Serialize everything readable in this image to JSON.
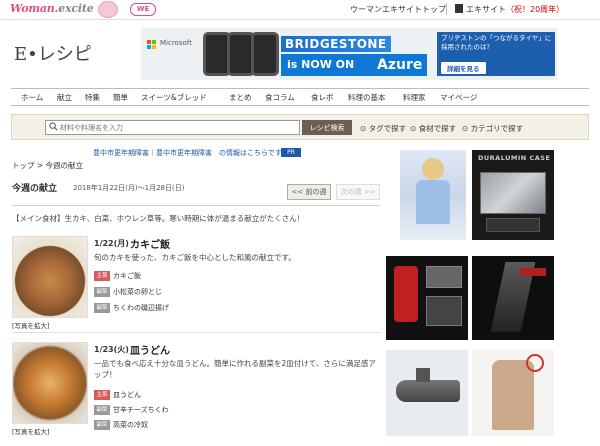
{
  "topbar": {
    "brand_part1": "Woman.",
    "brand_part2": "excite",
    "we_badge": "WE",
    "link1": "ウーマンエキサイトトップ",
    "link2_prefix": "エキサイト",
    "link2_red": "（祝！20周年）"
  },
  "logo": "E•レシピ",
  "banner": {
    "microsoft": "Microsoft",
    "title": "BRIDGESTONE",
    "now_prefix": "is NOW ON",
    "now_brand": "Azure",
    "side_text": "ブリヂストンの「つながるタイヤ」に採用されたのは？",
    "cta": "詳細を見る"
  },
  "nav": [
    "ホーム",
    "献立",
    "特集",
    "簡単",
    "スイーツ&ブレッド",
    "まとめ",
    "食コラム",
    "食レポ",
    "料理の基本",
    "料理家",
    "マイページ"
  ],
  "search": {
    "placeholder": "材料や料理名を入力",
    "button": "レシピ検索",
    "opt1": "タグで探す",
    "opt2": "食材で探す",
    "opt3": "カテゴリで探す"
  },
  "pr": {
    "line": "豊中市更年期障害｜豊中市更年期障害　の情報はこちらです",
    "badge": "PR"
  },
  "breadcrumb": "トップ > 今週の献立",
  "page": {
    "title": "今週の献立",
    "date_range": "2018年1月22日(月)〜1月28日(日)",
    "prev": "<< 前の週",
    "next": "次の週 >>",
    "note": "【メイン食材】生カキ、白菜、ホウレン草等。寒い時期に体が温まる献立がたくさん！"
  },
  "days": [
    {
      "date": "1/22(月)",
      "title": "カキご飯",
      "desc": "旬のカキを使った、カキご飯を中心とした和風の献立です。",
      "dishes": [
        {
          "tag": "主菜",
          "name": "カキご飯"
        },
        {
          "tag": "副菜",
          "name": "小松菜の卵とじ"
        },
        {
          "tag": "副菜",
          "name": "ちくわの磯辺揚げ"
        }
      ],
      "enlarge": "[写真を拡大]"
    },
    {
      "date": "1/23(火)",
      "title": "皿うどん",
      "desc": "一品でも食べ応え十分な皿うどん。簡単に作れる副菜を2皿付けて、さらに満足感アップ！",
      "dishes": [
        {
          "tag": "主菜",
          "name": "皿うどん"
        },
        {
          "tag": "副菜",
          "name": "甘辛チーズちくわ"
        },
        {
          "tag": "副菜",
          "name": "高菜の冷奴"
        }
      ],
      "enlarge": "[写真を拡大]"
    }
  ],
  "ads": {
    "duralumin": "DURALUMIN CASE"
  },
  "colors": {
    "brand_pink": "#e0507f",
    "azure_blue": "#0d79d4",
    "search_btn": "#6b5e52",
    "main_tag": "#d45b5b"
  }
}
